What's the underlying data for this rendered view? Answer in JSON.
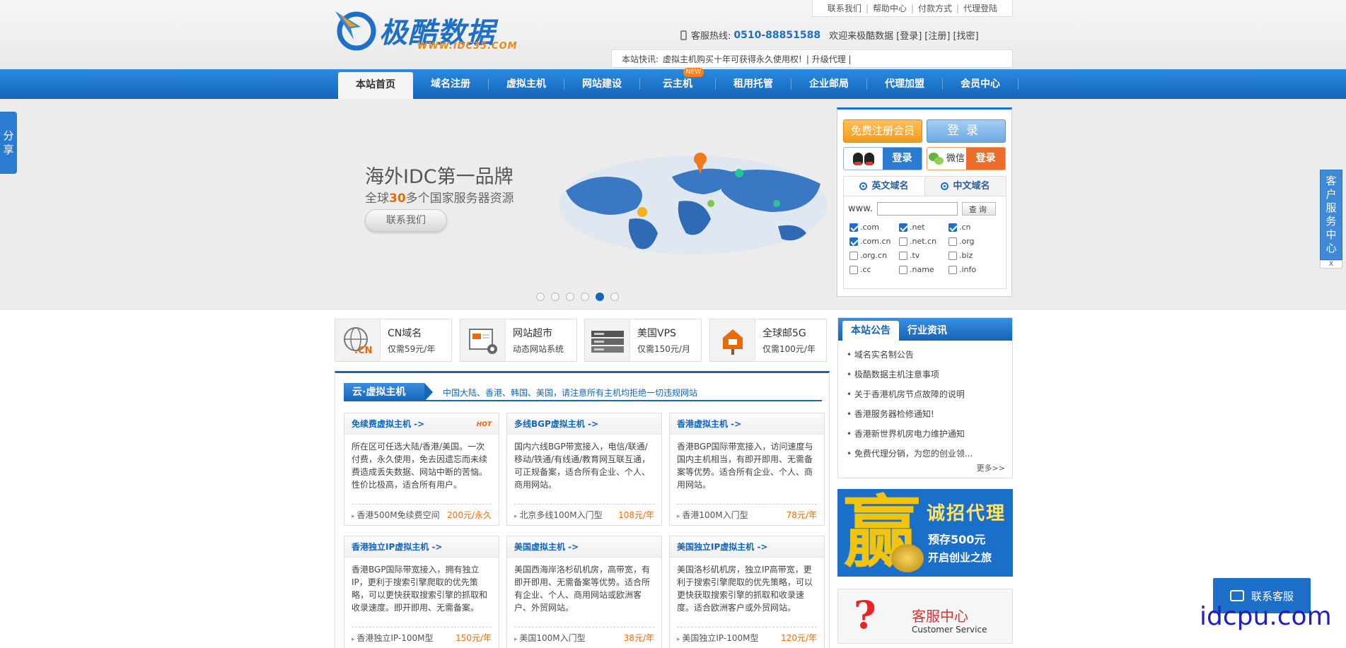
{
  "header": {
    "logo_name": "极酷数据",
    "logo_url": "WWW.IDC35.COM",
    "top_links": [
      "联系我们",
      "帮助中心",
      "付款方式",
      "代理登陆"
    ],
    "hotline_label": "客服热线:",
    "hotline_number": "0510-88851588",
    "welcome": "欢迎来极酷数据",
    "auth_links": [
      "[登录]",
      "[注册]",
      "[找密]"
    ],
    "news_label": "本站快讯:",
    "news_text": "虚拟主机购买十年可获得永久使用权!",
    "news_link": "| 升级代理 |"
  },
  "nav": {
    "items": [
      "本站首页",
      "域名注册",
      "虚拟主机",
      "网站建设",
      "云主机",
      "租用托管",
      "企业邮局",
      "代理加盟",
      "会员中心"
    ],
    "new_badge": "NEW"
  },
  "banner": {
    "title": "海外IDC第一品牌",
    "sub_before": "全球",
    "sub_number": "30",
    "sub_after": "多个国家服务器资源",
    "button": "联系我们",
    "slide_count": 6,
    "active_slide": 5
  },
  "login": {
    "register_label": "免费注册会员",
    "login_label": "登录",
    "qq_login": "登录",
    "wx_label": "微信",
    "wx_login": "登录"
  },
  "domain": {
    "tab_en": "英文域名",
    "tab_cn": "中文域名",
    "prefix": "www.",
    "input_value": "",
    "search_label": "查询",
    "tlds": [
      {
        "name": ".com",
        "checked": true
      },
      {
        "name": ".net",
        "checked": true
      },
      {
        "name": ".cn",
        "checked": true
      },
      {
        "name": ".com.cn",
        "checked": true
      },
      {
        "name": ".net.cn",
        "checked": false
      },
      {
        "name": ".org",
        "checked": false
      },
      {
        "name": ".org.cn",
        "checked": false
      },
      {
        "name": ".tv",
        "checked": false
      },
      {
        "name": ".biz",
        "checked": false
      },
      {
        "name": ".cc",
        "checked": false
      },
      {
        "name": ".name",
        "checked": false
      },
      {
        "name": ".info",
        "checked": false
      }
    ]
  },
  "side": {
    "share": "分享",
    "service": "客户服务中心",
    "close": "X"
  },
  "tiles": [
    {
      "title": "CN域名",
      "sub": "仅需59元/年",
      "badge": ".CN"
    },
    {
      "title": "网站超市",
      "sub": "动态网站系统"
    },
    {
      "title": "美国VPS",
      "sub": "仅需150元/月"
    },
    {
      "title": "全球邮5G",
      "sub": "仅需100元/年"
    }
  ],
  "hosting": {
    "label": "云·虚拟主机",
    "note": "中国大陆、香港、韩国、美国，请注意所有主机均拒绝一切违规网站",
    "hot": "HOT",
    "cards": [
      {
        "title": "免续费虚拟主机 ->",
        "desc": "所在区可任选大陆/香港/美国。一次付费，永久使用，免去因遗忘而未续费造成丢失数据、网站中断的苦恼。性价比极高，适合所有用户。",
        "plan": "香港500M免续费空间",
        "price": "200元/永久"
      },
      {
        "title": "多线BGP虚拟主机 ->",
        "desc": "国内六线BGP带宽接入，电信/联通/移动/铁通/有线通/教育网互联互通，可正规备案，适合所有企业、个人、商用网站。",
        "plan": "北京多线100M入门型",
        "price": "108元/年"
      },
      {
        "title": "香港虚拟主机 ->",
        "desc": "香港BGP国际带宽接入，访问速度与国内主机相当，有即开即用、无需备案等优势。适合所有企业、个人、商用网站。",
        "plan": "香港100M入门型",
        "price": "78元/年"
      },
      {
        "title": "香港独立IP虚拟主机 ->",
        "desc": "香港BGP国际带宽接入，拥有独立IP，更利于搜索引擎爬取的优先策略，可以更快获取搜索引擎的抓取和收录速度。即开即用、无需备案。",
        "plan": "香港独立IP-100M型",
        "price": "150元/年"
      },
      {
        "title": "美国虚拟主机 ->",
        "desc": "美国西海岸洛杉矶机房，高带宽，有即开即用、无需备案等优势。适合所有企业、个人、商用网站或欧洲客户、外贸网站。",
        "plan": "美国100M入门型",
        "price": "38元/年"
      },
      {
        "title": "美国独立IP虚拟主机 ->",
        "desc": "美国洛杉矶机房，独立IP高带宽，更利于搜索引擎爬取的优先策略，可以更快获取搜索引擎的抓取和收录速度。适合欧洲客户或外贸网站。",
        "plan": "美国独立IP-100M型",
        "price": "120元/年"
      }
    ]
  },
  "notice": {
    "tab_active": "本站公告",
    "tab_other": "行业资讯",
    "items": [
      "域名实名制公告",
      "极酷数据主机注意事项",
      "关于香港机房节点故障的说明",
      "香港服务器检修通知!",
      "香港新世界机房电力维护通知",
      "免费代理分销，为您的创业领..."
    ],
    "more": "更多>>"
  },
  "agent": {
    "big": "赢",
    "title": "诚招代理",
    "line1": "预存500元",
    "line2": "开启创业之旅",
    "dollar": "$"
  },
  "cs_box": {
    "title": "客服中心",
    "sub": "Customer Service"
  },
  "float_cs": "联系客服",
  "watermark": "idcpu.com"
}
